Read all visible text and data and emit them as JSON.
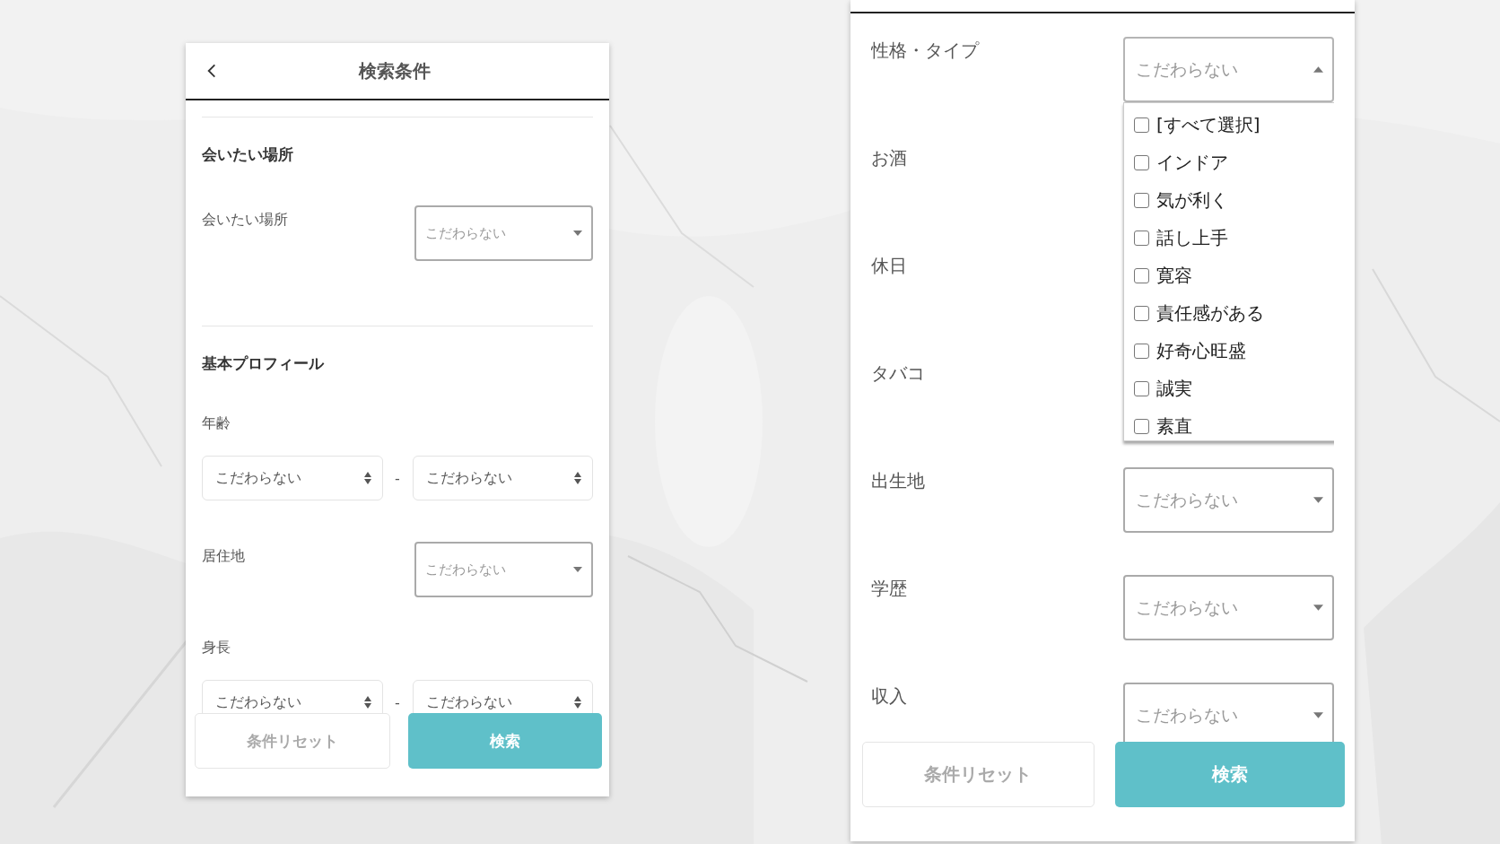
{
  "screens": [
    {
      "header": {
        "title": "検索条件"
      },
      "sections": [
        {
          "title": "会いたい場所",
          "fields": [
            {
              "kind": "select",
              "label": "会いたい場所",
              "value": "こだわらない",
              "expanded": false
            }
          ]
        },
        {
          "title": "基本プロフィール",
          "fields": [
            {
              "kind": "range",
              "label": "年齢",
              "from": "こだわらない",
              "separator": "-",
              "to": "こだわらない"
            },
            {
              "kind": "select",
              "label": "居住地",
              "value": "こだわらない",
              "expanded": false
            },
            {
              "kind": "range",
              "label": "身長",
              "from": "こだわらない",
              "separator": "-",
              "to": "こだわらない"
            }
          ]
        }
      ],
      "buttons": {
        "reset": "条件リセット",
        "search": "検索"
      }
    },
    {
      "sections": [
        {
          "fields": [
            {
              "kind": "select",
              "label": "性格・タイプ",
              "value": "こだわらない",
              "expanded": true,
              "options": [
                {
                  "label": "[すべて選択]",
                  "checked": false
                },
                {
                  "label": "インドア",
                  "checked": false
                },
                {
                  "label": "気が利く",
                  "checked": false
                },
                {
                  "label": "話し上手",
                  "checked": false
                },
                {
                  "label": "寛容",
                  "checked": false
                },
                {
                  "label": "責任感がある",
                  "checked": false
                },
                {
                  "label": "好奇心旺盛",
                  "checked": false
                },
                {
                  "label": "誠実",
                  "checked": false
                },
                {
                  "label": "素直",
                  "checked": false
                }
              ]
            },
            {
              "kind": "select",
              "label": "お酒"
            },
            {
              "kind": "select",
              "label": "休日"
            },
            {
              "kind": "select",
              "label": "タバコ"
            },
            {
              "kind": "select",
              "label": "出生地",
              "value": "こだわらない",
              "expanded": false
            },
            {
              "kind": "select",
              "label": "学歴",
              "value": "こだわらない",
              "expanded": false
            },
            {
              "kind": "select",
              "label": "収入",
              "value": "こだわらない",
              "expanded": false
            }
          ]
        }
      ],
      "buttons": {
        "reset": "条件リセット",
        "search": "検索"
      }
    }
  ]
}
